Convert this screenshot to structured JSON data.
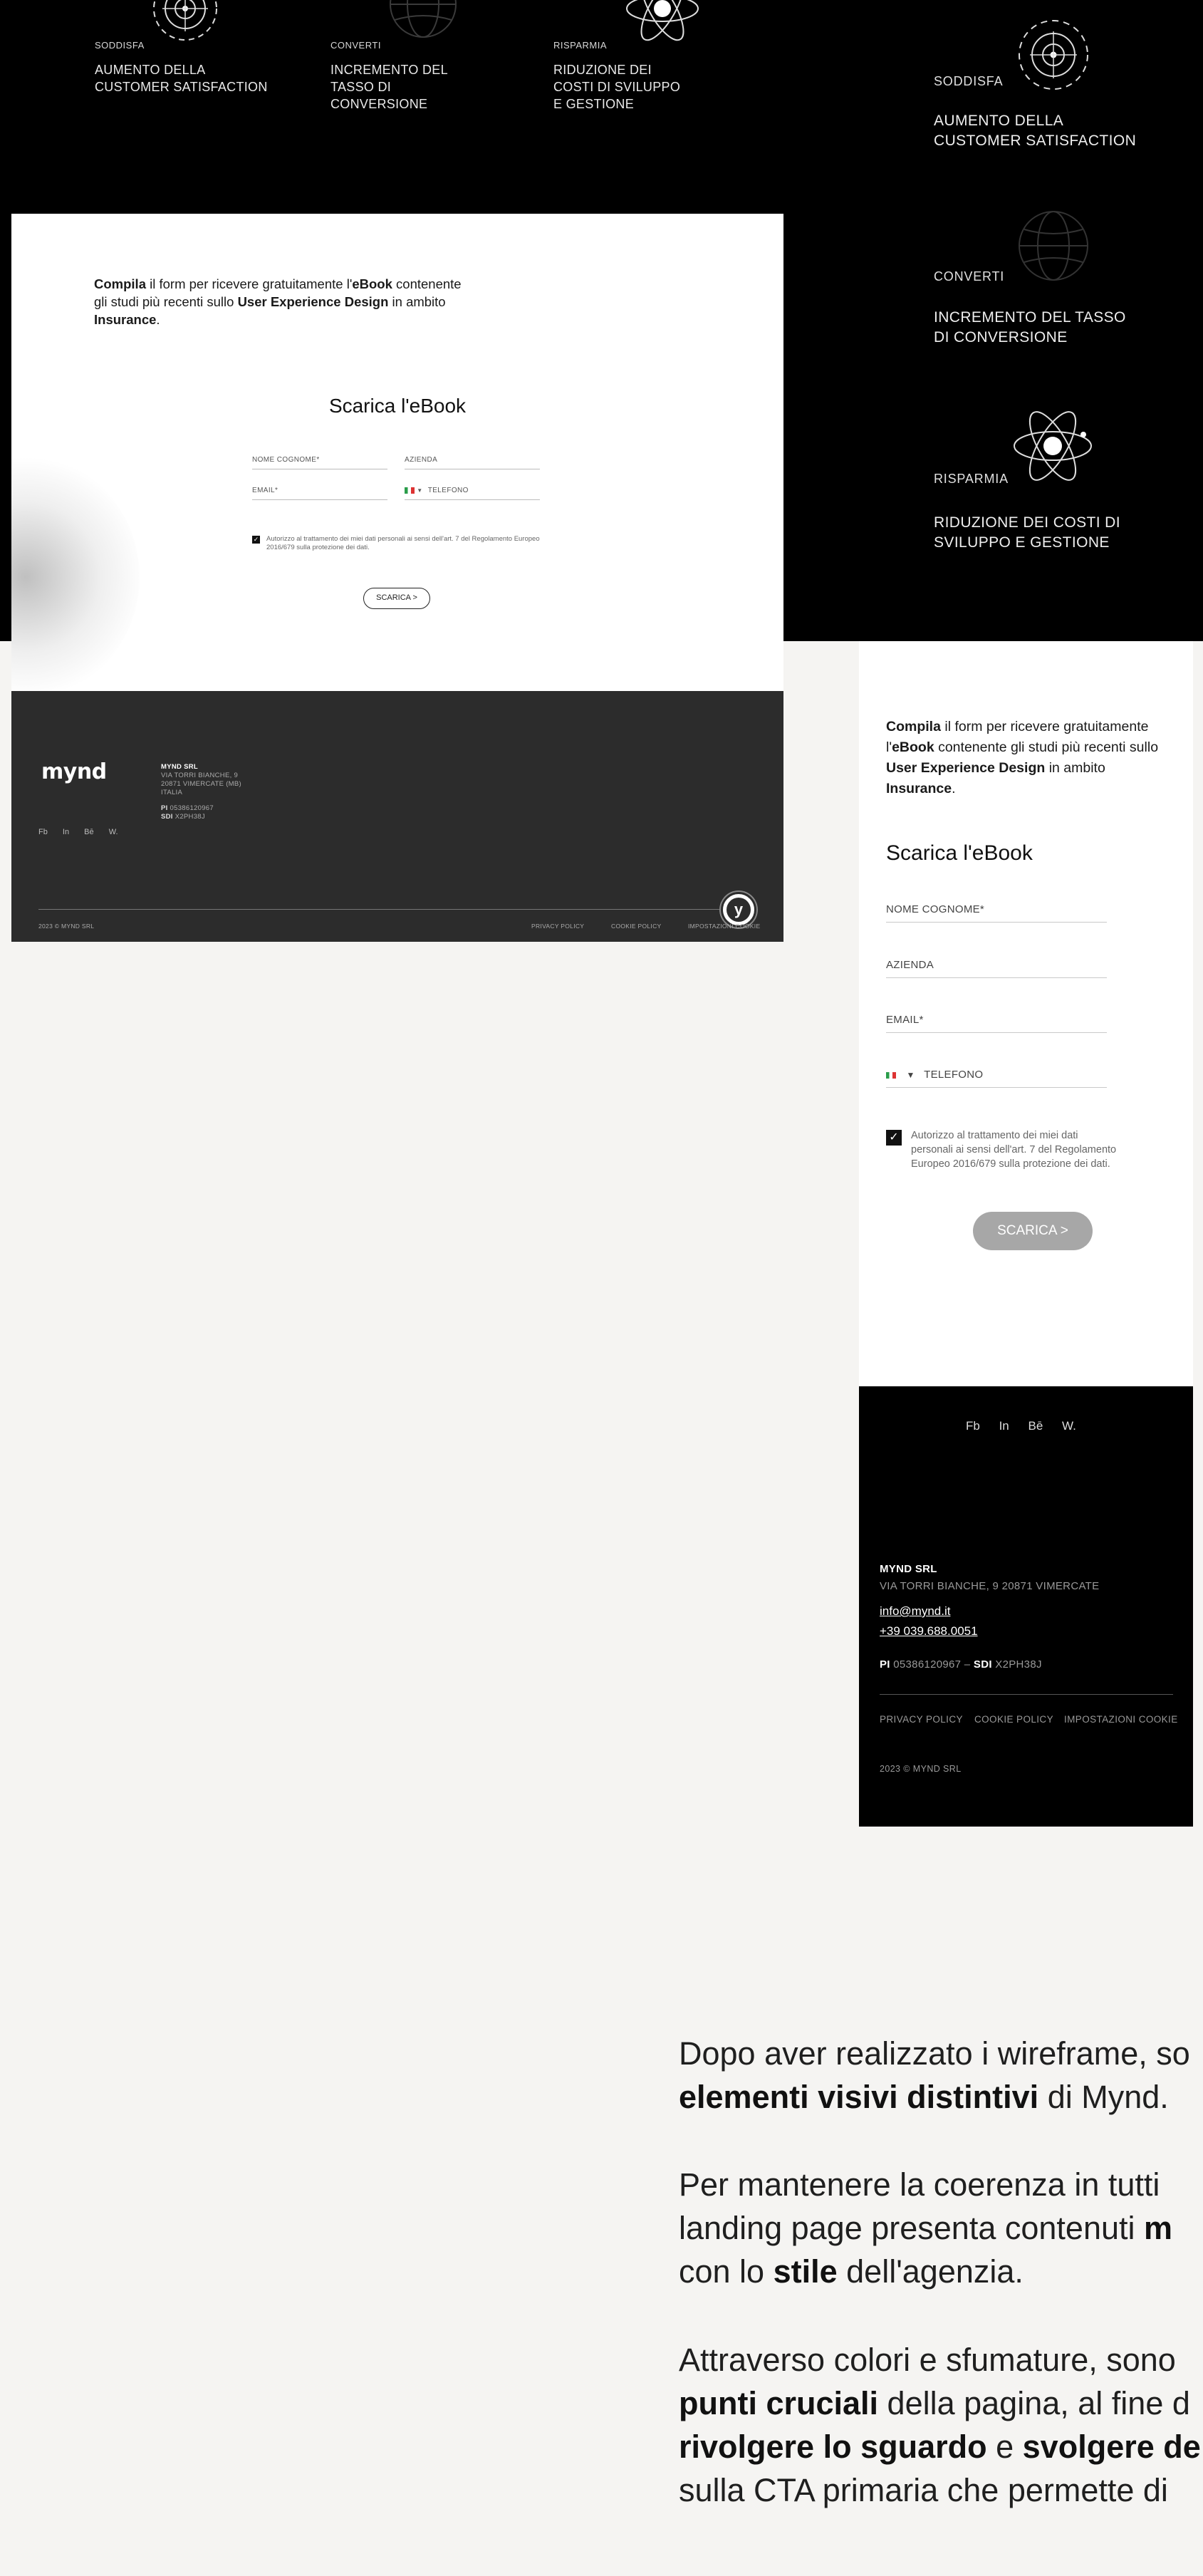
{
  "top_band": {
    "benefits": [
      {
        "kicker": "SODDISFA",
        "title_lines": [
          "AUMENTO DELLA",
          "CUSTOMER SATISFACTION"
        ],
        "icon": "target-icon"
      },
      {
        "kicker": "CONVERTI",
        "title_lines": [
          "INCREMENTO DEL",
          "TASSO DI",
          "CONVERSIONE"
        ],
        "icon": "globe-icon"
      },
      {
        "kicker": "RISPARMIA",
        "title_lines": [
          "RIDUZIONE DEI",
          "COSTI DI SVILUPPO",
          "E GESTIONE"
        ],
        "icon": "atom-icon"
      }
    ],
    "right_benefits": [
      {
        "kicker": "SODDISFA",
        "title_lines": [
          "AUMENTO DELLA",
          "CUSTOMER SATISFACTION"
        ],
        "icon": "target-icon"
      },
      {
        "kicker": "CONVERTI",
        "title_lines": [
          "INCREMENTO DEL TASSO",
          "DI CONVERSIONE"
        ],
        "icon": "globe-icon"
      },
      {
        "kicker": "RISPARMIA",
        "title_lines": [
          "RIDUZIONE DEI COSTI DI",
          "SVILUPPO E GESTIONE"
        ],
        "icon": "atom-icon"
      }
    ]
  },
  "desktop": {
    "intro": {
      "p1": "Compila",
      "p2": " il form per ricevere gratuitamente l'",
      "p3": "eBook",
      "p4": " contenente gli studi più recenti sullo ",
      "p5": "User Experience Design",
      "p6": " in ambito ",
      "p7": "Insurance",
      "p8": "."
    },
    "form_title": "Scarica l'eBook",
    "fields": {
      "name": "NOME COGNOME*",
      "company": "AZIENDA",
      "email": "EMAIL*",
      "phone": "TELEFONO"
    },
    "consent": "Autorizzo al trattamento dei miei dati personali ai sensi dell'art. 7 del Regolamento Europeo 2016/679 sulla protezione dei dati.",
    "button": "SCARICA >",
    "footer": {
      "logo": "mynd",
      "company": "MYND SRL",
      "address_lines": [
        "VIA TORRI BIANCHE, 9",
        "20871 VIMERCATE (MB)",
        "ITALIA"
      ],
      "pi_label": "PI",
      "pi_value": "05386120967",
      "sdi_label": "SDI",
      "sdi_value": "X2PH38J",
      "social": [
        "Fb",
        "In",
        "Bē",
        "W."
      ],
      "copyright": "2023 © MYND SRL",
      "legal": [
        "PRIVACY POLICY",
        "COOKIE POLICY",
        "IMPOSTAZIONI COOKIE"
      ],
      "badge": "y"
    }
  },
  "mobile": {
    "intro": {
      "p1": "Compila",
      "p2": " il form per ricevere gratuitamente l'",
      "p3": "eBook",
      "p4": "  contenente gli studi più recenti sullo ",
      "p5": "User Experience Design",
      "p6": " in ambito ",
      "p7": "Insurance",
      "p8": "."
    },
    "form_title": "Scarica l'eBook",
    "fields": {
      "name": "NOME COGNOME*",
      "company": "AZIENDA",
      "email": "EMAIL*",
      "phone": "TELEFONO"
    },
    "consent_lines": [
      "Autorizzo al trattamento dei miei dati",
      "personali ai sensi dell'art. 7 del Regolamento",
      "Europeo 2016/679 sulla protezione dei dati."
    ],
    "button": "SCARICA >",
    "footer": {
      "social": [
        "Fb",
        "In",
        "Bē",
        "W."
      ],
      "company": "MYND SRL",
      "address": "VIA TORRI BIANCHE, 9 20871 VIMERCATE",
      "email": "info@mynd.it",
      "phone": "+39 039.688.0051",
      "pi_label": "PI",
      "pi_value": "05386120967",
      "sep": "–",
      "sdi_label": "SDI",
      "sdi_value": "X2PH38J",
      "legal": [
        "PRIVACY POLICY",
        "COOKIE POLICY",
        "IMPOSTAZIONI COOKIE"
      ],
      "copyright": "2023 © MYND SRL"
    }
  },
  "body": {
    "para1": {
      "a": "Dopo aver realizzato i wireframe, so",
      "b": "elementi visivi distintivi",
      "c": " di Mynd."
    },
    "para2": {
      "a": "Per mantenere la coerenza in tutti ",
      "b": "landing page presenta contenuti ",
      "c": "m",
      "d": "con lo ",
      "e": "stile",
      "f": " dell'agenzia."
    },
    "para3": {
      "a": "Attraverso colori e sfumature, sono",
      "b": "punti cruciali",
      "c": " della pagina, al fine d",
      "d": "rivolgere lo sguardo",
      "e": " e ",
      "f": "svolgere de",
      "g": "sulla CTA primaria che permette di"
    }
  },
  "colors": {
    "background": "#f5f4f2",
    "black": "#000000",
    "footer_dark": "#2c2c2c",
    "button_grey": "#a7a7a7"
  }
}
